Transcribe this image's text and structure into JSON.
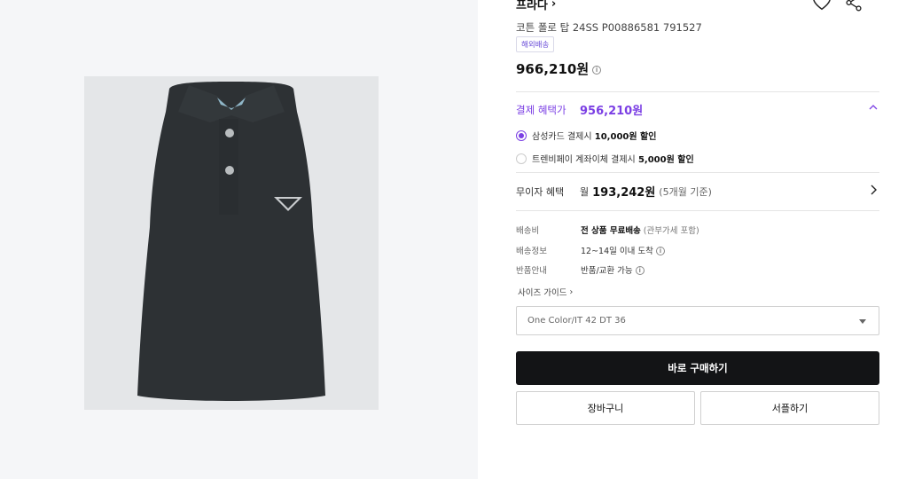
{
  "product": {
    "brand": "프라다",
    "name": "코튼 폴로 탑 24SS P00886581 791527",
    "tag": "해외배송",
    "price": "966,210원"
  },
  "benefit": {
    "label": "결제 혜택가",
    "price": "956,210원",
    "options": [
      {
        "prefix": "삼성카드 결제시 ",
        "amount": "10,000원 할인",
        "selected": true
      },
      {
        "prefix": "트렌비페이 계좌이체 결제시 ",
        "amount": "5,000원 할인",
        "selected": false
      }
    ]
  },
  "installment": {
    "label": "무이자 혜택",
    "prefix": "월",
    "amount": "193,242원",
    "note": "(5개월 기준)"
  },
  "shipping": {
    "fee_label": "배송비",
    "fee_value": "전 상품 무료배송",
    "fee_note": "(관부가세 포함)",
    "info_label": "배송정보",
    "info_value": "12~14일 이내 도착",
    "return_label": "반품안내",
    "return_value": "반품/교환 가능"
  },
  "size_guide": "사이즈 가이드",
  "option_select": {
    "selected": "One Color/IT 42 DT 36"
  },
  "actions": {
    "buy": "바로 구매하기",
    "cart": "장바구니",
    "gift": "서플하기"
  },
  "icons": {
    "wishlist": "heart-icon",
    "share": "share-icon",
    "info": "info-icon"
  },
  "colors": {
    "accent": "#7b3fe4",
    "buy_button": "#131416"
  }
}
